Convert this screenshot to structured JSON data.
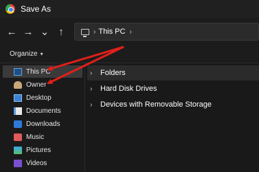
{
  "window": {
    "title": "Save As",
    "app_icon": "chrome-icon"
  },
  "nav": {
    "back_icon": "arrow-left-icon",
    "forward_icon": "arrow-right-icon",
    "recent_icon": "chevron-down-icon",
    "up_icon": "arrow-up-icon",
    "back_glyph": "←",
    "forward_glyph": "→",
    "recent_glyph": "⌄",
    "up_glyph": "↑"
  },
  "address": {
    "location": "This PC",
    "separator": "›",
    "trailing_separator": "›"
  },
  "toolbar": {
    "organize_label": "Organize",
    "organize_caret": "▾"
  },
  "sidebar": {
    "items": [
      {
        "label": "This PC",
        "icon": "computer-icon",
        "selected": true
      },
      {
        "label": "Owner",
        "icon": "user-folder-icon"
      },
      {
        "label": "Desktop",
        "icon": "desktop-icon"
      },
      {
        "label": "Documents",
        "icon": "documents-icon"
      },
      {
        "label": "Downloads",
        "icon": "downloads-icon"
      },
      {
        "label": "Music",
        "icon": "music-icon"
      },
      {
        "label": "Pictures",
        "icon": "pictures-icon"
      },
      {
        "label": "Videos",
        "icon": "videos-icon"
      }
    ]
  },
  "main": {
    "groups": [
      {
        "label": "Folders",
        "selected": true,
        "chevron": "›"
      },
      {
        "label": "Hard Disk Drives",
        "chevron": "›"
      },
      {
        "label": "Devices with Removable Storage",
        "chevron": "›"
      }
    ]
  },
  "annotations": {
    "arrow_color": "#e0201a"
  },
  "colors": {
    "background": "#191919",
    "selected_sidebar": "#3a3a3a",
    "selected_group": "#2b2b2b"
  }
}
